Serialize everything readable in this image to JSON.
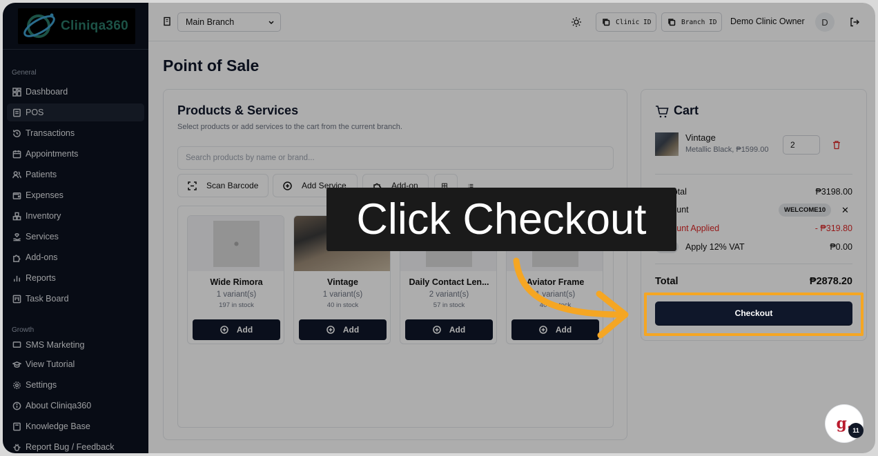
{
  "brand": {
    "name": "Cliniqa360"
  },
  "sidebar": {
    "group_general": "General",
    "group_growth": "Growth",
    "items": [
      {
        "label": "Dashboard"
      },
      {
        "label": "POS"
      },
      {
        "label": "Transactions"
      },
      {
        "label": "Appointments"
      },
      {
        "label": "Patients"
      },
      {
        "label": "Expenses"
      },
      {
        "label": "Inventory"
      },
      {
        "label": "Services"
      },
      {
        "label": "Add-ons"
      },
      {
        "label": "Reports"
      },
      {
        "label": "Task Board"
      }
    ],
    "growth_items": [
      {
        "label": "SMS Marketing"
      }
    ],
    "footer_items": [
      {
        "label": "View Tutorial"
      },
      {
        "label": "Settings"
      },
      {
        "label": "About Cliniqa360"
      },
      {
        "label": "Knowledge Base"
      },
      {
        "label": "Report Bug / Feedback"
      }
    ]
  },
  "topbar": {
    "branch_selected": "Main Branch",
    "clinic_id_label": "Clinic ID",
    "branch_id_label": "Branch ID",
    "user_name": "Demo Clinic Owner",
    "avatar_initial": "D"
  },
  "page": {
    "title": "Point of Sale"
  },
  "products": {
    "title": "Products & Services",
    "subtitle": "Select products or add services to the cart from the current branch.",
    "search_placeholder": "Search products by name or brand...",
    "scan_label": "Scan Barcode",
    "add_service_label": "Add Service",
    "addon_label": "Add-on",
    "add_label": "Add",
    "items": [
      {
        "name": "Wide Rimora",
        "variants": "1 variant(s)",
        "stock": "197 in stock"
      },
      {
        "name": "Vintage",
        "variants": "1 variant(s)",
        "stock": "40 in stock"
      },
      {
        "name": "Daily Contact Len...",
        "variants": "2 variant(s)",
        "stock": "57 in stock"
      },
      {
        "name": "Aviator Frame",
        "variants": "1 variant(s)",
        "stock": "40 in stock"
      }
    ]
  },
  "cart": {
    "title": "Cart",
    "item": {
      "name": "Vintage",
      "meta": "Metallic Black, ₱1599.00",
      "qty": "2"
    },
    "subtotal_label": "Subtotal",
    "subtotal_value": "₱3198.00",
    "discount_label": "Discount",
    "coupon_code": "WELCOME10",
    "discount_applied_label": "Discount Applied",
    "discount_applied_value": "- ₱319.80",
    "vat_label": "Apply 12% VAT",
    "vat_value": "₱0.00",
    "total_label": "Total",
    "total_value": "₱2878.20",
    "checkout_label": "Checkout"
  },
  "overlay": {
    "callout": "Click Checkout",
    "accent_color": "#f5a623"
  },
  "help": {
    "glyph": "g.",
    "badge": "11"
  }
}
